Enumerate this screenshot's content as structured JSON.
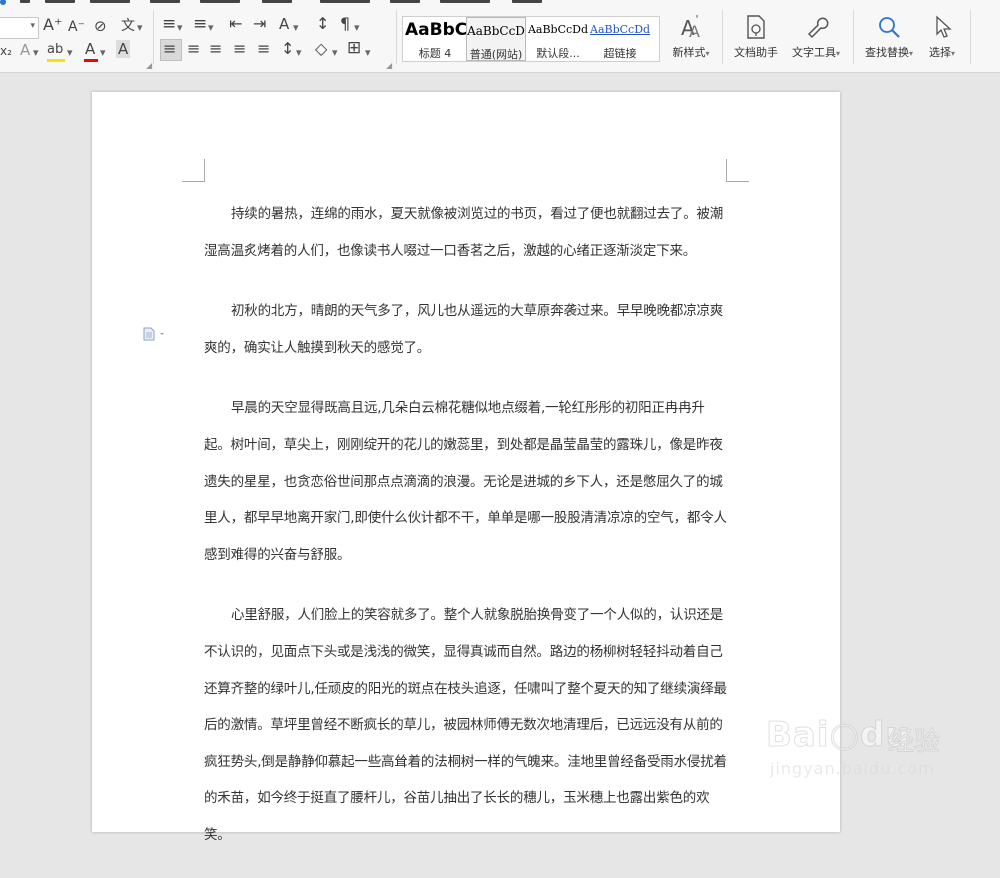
{
  "toolbar": {
    "font": {
      "grow_label": "A⁺",
      "shrink_label": "A⁻",
      "clear_label": "⊘",
      "phonetic_label": "文",
      "script_label": "x₂",
      "effect_label": "A",
      "highlight_label": "ab",
      "color_label": "A",
      "char_shade_label": "A",
      "highlight_color": "#f6e100",
      "font_color": "#ff0000"
    },
    "paragraph": {
      "bullets_label": "≡",
      "numbering_label": "≡",
      "decrease_indent_label": "⇤",
      "increase_indent_label": "⇥",
      "text_direction_label": "A",
      "sort_label": "↕",
      "show_marks_label": "¶",
      "align_left_label": "≡",
      "align_center_label": "≡",
      "align_right_label": "≡",
      "justify_label": "≡",
      "distributed_label": "≡",
      "line_spacing_label": "↕",
      "shading_label": "◇",
      "borders_label": "⊞"
    },
    "styles": [
      {
        "preview": "AaBbC",
        "name": "标题 4"
      },
      {
        "preview": "AaBbCcD",
        "name": "普通(网站)"
      },
      {
        "preview": "AaBbCcDd",
        "name": "默认段..."
      },
      {
        "preview": "AaBbCcDd",
        "name": "超链接"
      }
    ],
    "new_style_label": "新样式",
    "doc_assistant_label": "文档助手",
    "text_tools_label": "文字工具",
    "find_replace_label": "查找替换",
    "select_label": "选择",
    "accent_color": "#2b73d6"
  },
  "document": {
    "paragraphs": [
      "持续的暑热，连绵的雨水，夏天就像被浏览过的书页，看过了便也就翻过去了。被潮湿高温炙烤着的人们，也像读书人啜过一口香茗之后，激越的心绪正逐渐淡定下来。",
      "初秋的北方，晴朗的天气多了，风儿也从遥远的大草原奔袭过来。早早晚晚都凉凉爽爽的，确实让人触摸到秋天的感觉了。",
      "早晨的天空显得既高且远,几朵白云棉花糖似地点缀着,一轮红彤彤的初阳正冉冉升起。树叶间，草尖上，刚刚绽开的花儿的嫩蕊里，到处都是晶莹晶莹的露珠儿，像是昨夜遗失的星星，也贪恋俗世间那点点滴滴的浪漫。无论是进城的乡下人，还是憋屈久了的城里人，都早早地离开家门,即使什么伙计都不干，单单是哪一股股清清凉凉的空气，都令人感到难得的兴奋与舒服。",
      "心里舒服，人们脸上的笑容就多了。整个人就象脱胎换骨变了一个人似的，认识还是不认识的，见面点下头或是浅浅的微笑，显得真诚而自然。路边的杨柳树轻轻抖动着自己还算齐整的绿叶儿,任顽皮的阳光的斑点在枝头追逐，任啸叫了整个夏天的知了继续演绎最后的激情。草坪里曾经不断疯长的草儿，被园林师傅无数次地清理后，已远远没有从前的疯狂势头,倒是静静仰慕起一些高耸着的法桐树一样的气魄来。洼地里曾经备受雨水侵扰着的禾苗，如今终于挺直了腰杆儿，谷苗儿抽出了长长的穗儿，玉米穗上也露出紫色的欢笑。"
    ]
  },
  "watermark": {
    "brand": "Bai○du",
    "cn": "经验",
    "url": "jingyan.baidu.com"
  }
}
